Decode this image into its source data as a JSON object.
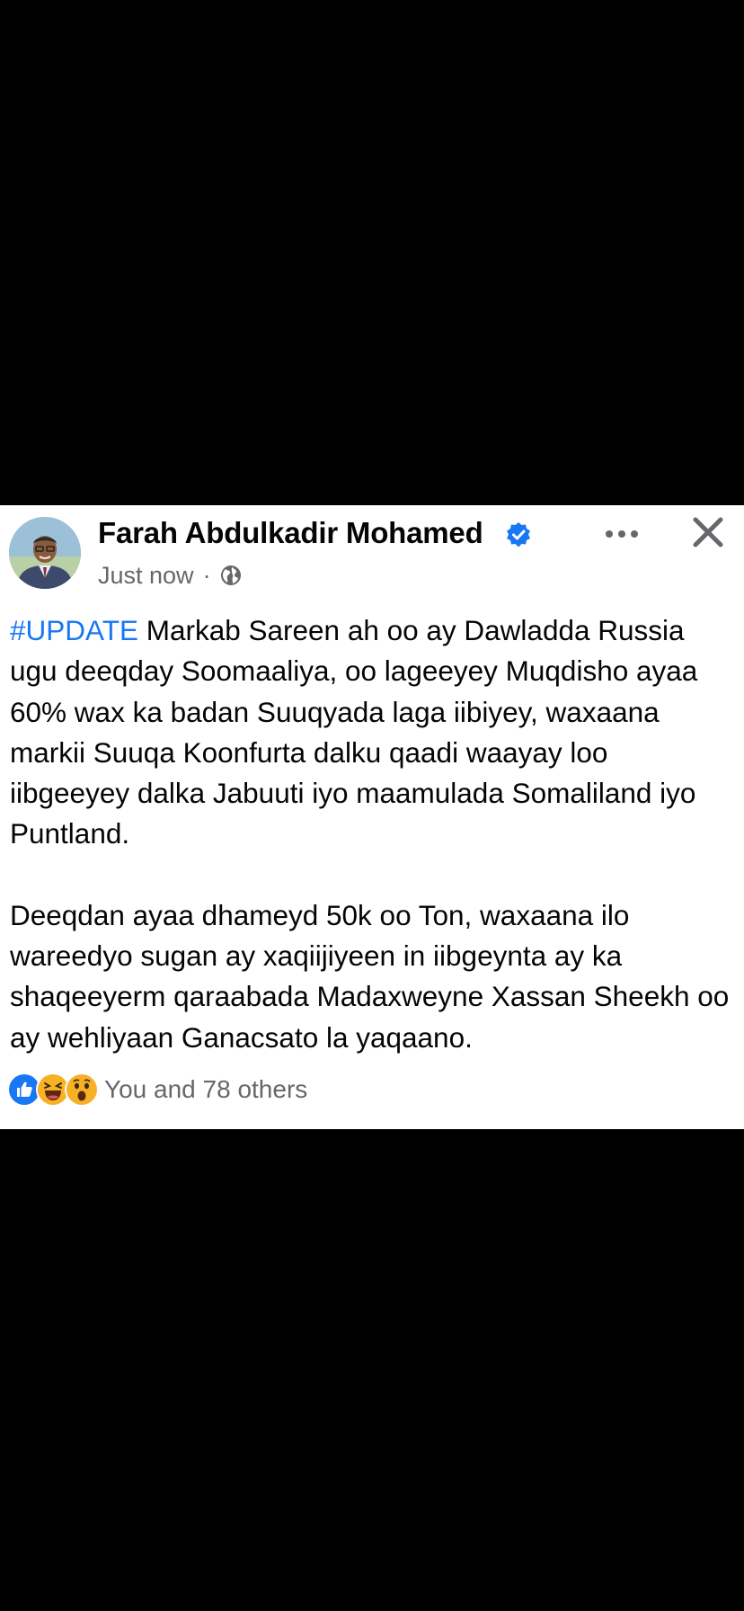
{
  "post": {
    "author_name": "Farah Abdulkadir Mohamed",
    "timestamp": "Just now",
    "separator": "·",
    "privacy_icon": "globe-icon",
    "verified_icon": "verified-badge-icon",
    "more_icon": "more-horizontal-icon",
    "close_icon": "close-icon",
    "hashtag": "#UPDATE",
    "paragraph1_text": " Markab Sareen ah oo ay Dawladda Russia ugu deeqday Soomaaliya, oo lageeyey Muqdisho ayaa 60% wax ka badan Suuqyada laga iibiyey, waxaana markii Suuqa Koonfurta dalku qaadi waayay loo iibgeeyey dalka Jabuuti iyo maamulada Somaliland iyo Puntland.",
    "paragraph2": "Deeqdan ayaa dhameyd 50k oo Ton, waxaana ilo wareedyo sugan ay xaqiijiyeen in iibgeynta ay ka shaqeeyerm qaraabada Madaxweyne Xassan Sheekh oo ay wehliyaan Ganacsato la yaqaano.",
    "reactions": {
      "icons": [
        "like-reaction-icon",
        "haha-reaction-icon",
        "wow-reaction-icon"
      ],
      "count_text": "You and 78 others"
    }
  },
  "colors": {
    "background": "#000000",
    "card": "#ffffff",
    "text": "#050505",
    "secondary_text": "#65676b",
    "hashtag": "#1877f2",
    "verified": "#1877f2"
  }
}
